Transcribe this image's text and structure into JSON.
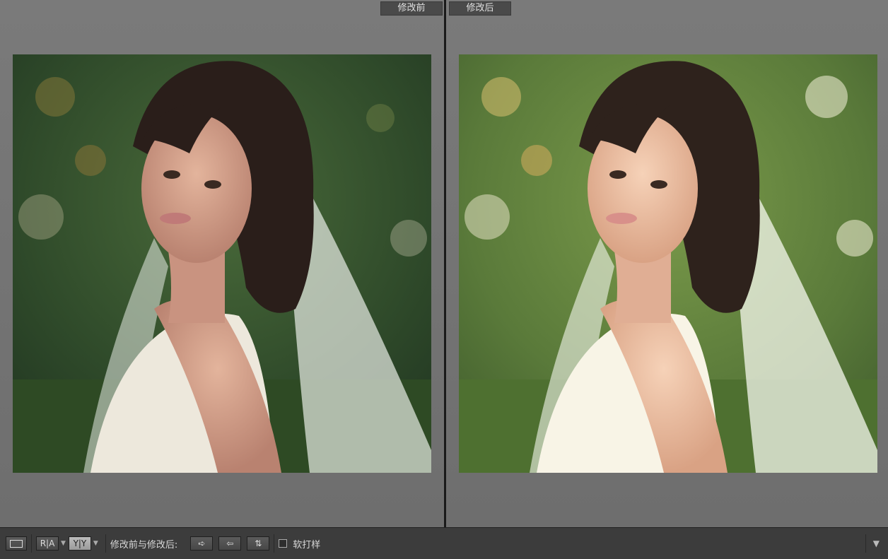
{
  "labels": {
    "before": "修改前",
    "after": "修改后"
  },
  "toolbar": {
    "view_ra": "R|A",
    "view_yy": "Y|Y",
    "before_after_label": "修改前与修改后:",
    "soft_proof_label": "软打样",
    "icons": [
      "loupe-view-icon",
      "swap-right-icon",
      "swap-left-icon",
      "swap-both-icon",
      "toolbar-menu-chevron-icon"
    ]
  },
  "photos": {
    "before": "bride portrait with veil, original",
    "after": "bride portrait with veil, edited brighter and warmer"
  },
  "colors": {
    "pane_bg": "#737373",
    "toolbar_bg": "#3c3c3c",
    "label_bg": "#4a4a4a"
  }
}
